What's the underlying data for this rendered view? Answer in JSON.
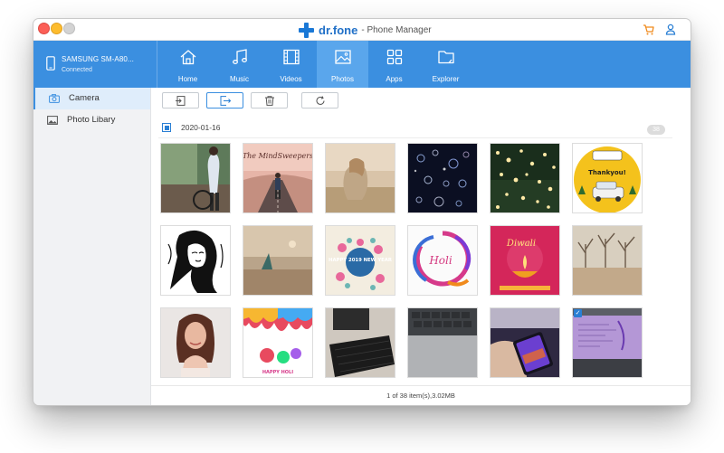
{
  "app": {
    "brand": "dr.fone",
    "subtitle": "- Phone Manager"
  },
  "device": {
    "name": "SAMSUNG SM-A80...",
    "status": "Connected"
  },
  "tabs": [
    {
      "label": "Home",
      "icon": "home-icon"
    },
    {
      "label": "Music",
      "icon": "music-icon"
    },
    {
      "label": "Videos",
      "icon": "film-icon"
    },
    {
      "label": "Photos",
      "icon": "image-icon",
      "active": true
    },
    {
      "label": "Apps",
      "icon": "apps-grid-icon"
    },
    {
      "label": "Explorer",
      "icon": "folder-icon"
    }
  ],
  "sidebar": {
    "items": [
      {
        "label": "Camera",
        "icon": "camera-icon",
        "active": true
      },
      {
        "label": "Photo Libary",
        "icon": "photo-icon"
      }
    ]
  },
  "toolbar": {
    "buttons": [
      "import-icon",
      "export-icon",
      "trash-icon",
      "refresh-icon"
    ]
  },
  "group": {
    "date": "2020-01-16",
    "count": "38",
    "checked": true
  },
  "photos": [
    {
      "description": "cyclist"
    },
    {
      "text": "The MindSweepers",
      "description": "road"
    },
    {
      "description": "woman-in-field"
    },
    {
      "description": "bokeh-night"
    },
    {
      "description": "string-lights"
    },
    {
      "text": "Thankyou!",
      "description": "taxi-poster"
    },
    {
      "description": "woman-line-art"
    },
    {
      "description": "sunset-beach"
    },
    {
      "text": "HAPPY 2019 NEW YEAR",
      "description": "new-year-card"
    },
    {
      "text": "Holi",
      "description": "holi-card"
    },
    {
      "text": "Diwali",
      "description": "diwali-card"
    },
    {
      "description": "bare-trees"
    },
    {
      "description": "woman-portrait"
    },
    {
      "text": "HAPPY HOLI",
      "description": "holi-paint"
    },
    {
      "description": "keyboard-dark"
    },
    {
      "description": "laptop-keyboard"
    },
    {
      "description": "phone-hand"
    },
    {
      "description": "screen-photo",
      "selected": true
    }
  ],
  "status_text": "1 of 38 item(s),3.02MB",
  "colors": {
    "accent": "#3b8fe0",
    "active_tab": "#5aa6ec",
    "brand": "#1a78d6"
  }
}
